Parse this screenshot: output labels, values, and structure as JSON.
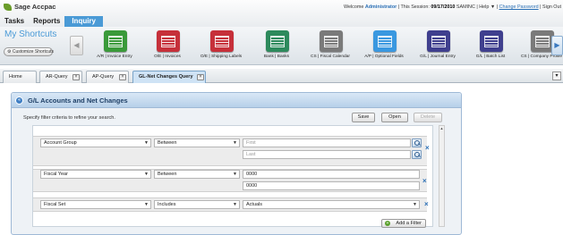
{
  "brand": {
    "name": "Sage Accpac"
  },
  "welcome": {
    "prefix": "Welcome",
    "user": "Administrator",
    "session_label": "| This Session:",
    "session_date": "09/17/2010",
    "company": "SAMINC",
    "help": "| Help ▼ |",
    "change_password": "Change Password",
    "sign_out": "| Sign Out"
  },
  "nav": {
    "tasks": "Tasks",
    "reports": "Reports",
    "inquiry": "Inquiry"
  },
  "shortcuts": {
    "title": "My Shortcuts",
    "customize": "Customize Shortcuts",
    "items": [
      {
        "label": "A/R | Invoice Entry",
        "color": "#3a9a3a",
        "icon": "invoice-entry-icon"
      },
      {
        "label": "O/E | Invoices",
        "color": "#c6303a",
        "icon": "invoices-icon"
      },
      {
        "label": "O/E | Shipping Labels",
        "color": "#c6303a",
        "icon": "shipping-labels-icon"
      },
      {
        "label": "Bank | Banks",
        "color": "#2d8a5c",
        "icon": "bank-icon"
      },
      {
        "label": "CS | Fiscal Calendar",
        "color": "#7a7a7a",
        "icon": "fiscal-calendar-icon"
      },
      {
        "label": "A/P | Optional Fields",
        "color": "#3a98e0",
        "icon": "optional-fields-icon"
      },
      {
        "label": "G/L | Journal Entry",
        "color": "#3f3f8e",
        "icon": "journal-entry-icon"
      },
      {
        "label": "G/L | Batch List",
        "color": "#3f3f8e",
        "icon": "batch-list-icon"
      },
      {
        "label": "CS | Company Profile",
        "color": "#7a7a7a",
        "icon": "company-profile-icon"
      }
    ]
  },
  "tabs": {
    "home": "Home",
    "ar_query": "AR-Query",
    "ap_query": "AP-Query",
    "gl_query": "GL-Net Changes Query"
  },
  "panel": {
    "title": "G/L Accounts and Net Changes",
    "instructions": "Specify filter criteria to refine your search.",
    "save": "Save",
    "open": "Open",
    "delete": "Delete"
  },
  "filters": [
    {
      "field": "Account Group",
      "operator": "Between",
      "from_placeholder": "First",
      "to_placeholder": "Last"
    },
    {
      "field": "Fiscal Year",
      "operator": "Between",
      "from_value": "0000",
      "to_value": "0000"
    },
    {
      "field": "Fiscal Set",
      "operator": "Includes",
      "value": "Actuals"
    }
  ],
  "add_filter": "Add a Filter"
}
